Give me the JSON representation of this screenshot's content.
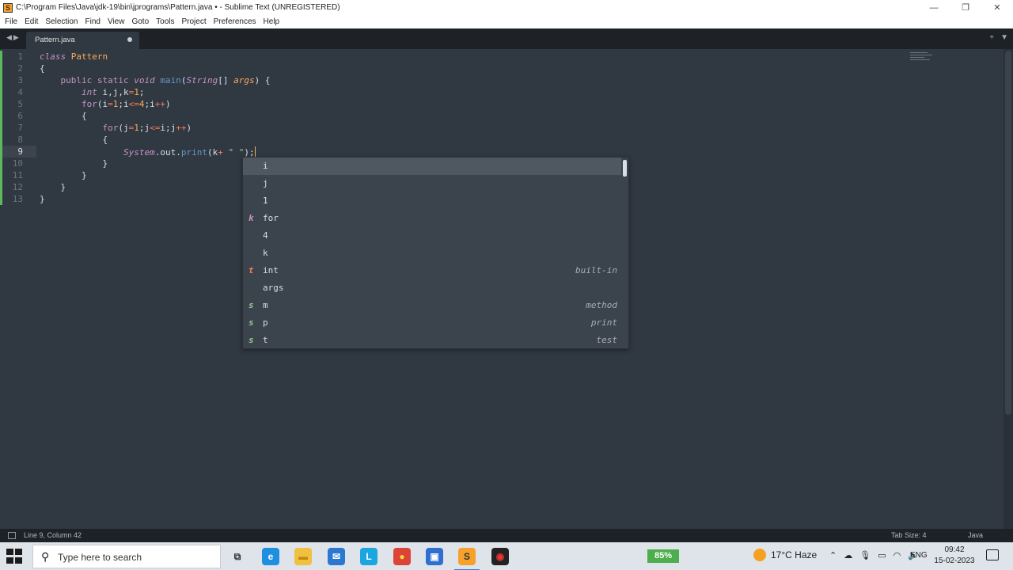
{
  "window": {
    "title": "C:\\Program Files\\Java\\jdk-19\\bin\\jprograms\\Pattern.java • - Sublime Text (UNREGISTERED)",
    "controls": [
      "minimize",
      "restore",
      "close"
    ]
  },
  "menu": [
    "File",
    "Edit",
    "Selection",
    "Find",
    "View",
    "Goto",
    "Tools",
    "Project",
    "Preferences",
    "Help"
  ],
  "tab": {
    "name": "Pattern.java",
    "dirty": true
  },
  "editor": {
    "line_numbers": [
      "1",
      "2",
      "3",
      "4",
      "5",
      "6",
      "7",
      "8",
      "9",
      "10",
      "11",
      "12",
      "13"
    ],
    "active_line": 9,
    "lines": [
      [
        {
          "t": "class",
          "c": "kw"
        },
        {
          "t": " ",
          "c": ""
        },
        {
          "t": "Pattern",
          "c": "cls"
        }
      ],
      [
        {
          "t": "{",
          "c": ""
        }
      ],
      [
        {
          "t": "    ",
          "c": ""
        },
        {
          "t": "public",
          "c": "kw2"
        },
        {
          "t": " ",
          "c": ""
        },
        {
          "t": "static",
          "c": "kw2"
        },
        {
          "t": " ",
          "c": ""
        },
        {
          "t": "void",
          "c": "kw"
        },
        {
          "t": " ",
          "c": ""
        },
        {
          "t": "main",
          "c": "fn"
        },
        {
          "t": "(",
          "c": ""
        },
        {
          "t": "String",
          "c": "ty"
        },
        {
          "t": "[] ",
          "c": ""
        },
        {
          "t": "args",
          "c": "par"
        },
        {
          "t": ") {",
          "c": ""
        }
      ],
      [
        {
          "t": "        ",
          "c": ""
        },
        {
          "t": "int",
          "c": "kw"
        },
        {
          "t": " i,j,k",
          "c": ""
        },
        {
          "t": "=",
          "c": "op"
        },
        {
          "t": "1",
          "c": "num"
        },
        {
          "t": ";",
          "c": ""
        }
      ],
      [
        {
          "t": "        ",
          "c": ""
        },
        {
          "t": "for",
          "c": "kw2"
        },
        {
          "t": "(i",
          "c": ""
        },
        {
          "t": "=",
          "c": "op"
        },
        {
          "t": "1",
          "c": "num"
        },
        {
          "t": ";i",
          "c": ""
        },
        {
          "t": "<=",
          "c": "op"
        },
        {
          "t": "4",
          "c": "num"
        },
        {
          "t": ";i",
          "c": ""
        },
        {
          "t": "++",
          "c": "op"
        },
        {
          "t": ")",
          "c": ""
        }
      ],
      [
        {
          "t": "        {",
          "c": ""
        }
      ],
      [
        {
          "t": "            ",
          "c": ""
        },
        {
          "t": "for",
          "c": "kw2"
        },
        {
          "t": "(j",
          "c": ""
        },
        {
          "t": "=",
          "c": "op"
        },
        {
          "t": "1",
          "c": "num"
        },
        {
          "t": ";j",
          "c": ""
        },
        {
          "t": "<=",
          "c": "op"
        },
        {
          "t": "i;j",
          "c": ""
        },
        {
          "t": "++",
          "c": "op"
        },
        {
          "t": ")",
          "c": ""
        }
      ],
      [
        {
          "t": "            {",
          "c": ""
        }
      ],
      [
        {
          "t": "                ",
          "c": ""
        },
        {
          "t": "System",
          "c": "ty"
        },
        {
          "t": ".out.",
          "c": "obj"
        },
        {
          "t": "print",
          "c": "fn"
        },
        {
          "t": "(k",
          "c": ""
        },
        {
          "t": "+",
          "c": "op"
        },
        {
          "t": " ",
          "c": ""
        },
        {
          "t": "\" \"",
          "c": "str"
        },
        {
          "t": ");",
          "c": ""
        }
      ],
      [
        {
          "t": "            }",
          "c": ""
        }
      ],
      [
        {
          "t": "        }",
          "c": ""
        }
      ],
      [
        {
          "t": "    }",
          "c": ""
        }
      ],
      [
        {
          "t": "}",
          "c": ""
        }
      ]
    ]
  },
  "autocomplete": {
    "items": [
      {
        "kind": "",
        "kind_color": "",
        "label": "i",
        "hint": ""
      },
      {
        "kind": "",
        "kind_color": "",
        "label": "j",
        "hint": ""
      },
      {
        "kind": "",
        "kind_color": "",
        "label": "1",
        "hint": ""
      },
      {
        "kind": "k",
        "kind_color": "#c594c5",
        "label": "for",
        "hint": ""
      },
      {
        "kind": "",
        "kind_color": "",
        "label": "4",
        "hint": ""
      },
      {
        "kind": "",
        "kind_color": "",
        "label": "k",
        "hint": ""
      },
      {
        "kind": "t",
        "kind_color": "#f97b58",
        "label": "int",
        "hint": "built-in"
      },
      {
        "kind": "",
        "kind_color": "",
        "label": "args",
        "hint": ""
      },
      {
        "kind": "s",
        "kind_color": "#99c794",
        "label": "m",
        "hint": "method"
      },
      {
        "kind": "s",
        "kind_color": "#99c794",
        "label": "p",
        "hint": "print"
      },
      {
        "kind": "s",
        "kind_color": "#99c794",
        "label": "t",
        "hint": "test"
      }
    ],
    "selected_index": 0
  },
  "statusbar": {
    "position": "Line 9, Column 42",
    "tab_size": "Tab Size: 4",
    "syntax": "Java"
  },
  "taskbar": {
    "search_placeholder": "Type here to search",
    "battery": "85%",
    "weather": "17°C  Haze",
    "language": "ENG",
    "time": "09:42",
    "date": "15-02-2023",
    "apps": [
      {
        "name": "task-view-icon",
        "color": "transparent",
        "glyph": "⧉",
        "fg": "#333"
      },
      {
        "name": "edge-icon",
        "color": "#1f8fe0",
        "glyph": "e",
        "fg": "#fff"
      },
      {
        "name": "file-explorer-icon",
        "color": "#f0c040",
        "glyph": "▬",
        "fg": "#c08a10"
      },
      {
        "name": "mail-icon",
        "color": "#2b78d0",
        "glyph": "✉",
        "fg": "#fff"
      },
      {
        "name": "l-app-icon",
        "color": "#1aa6e0",
        "glyph": "L",
        "fg": "#fff"
      },
      {
        "name": "chrome-icon",
        "color": "#db4437",
        "glyph": "●",
        "fg": "#fdd835"
      },
      {
        "name": "store-icon",
        "color": "#2f6fd0",
        "glyph": "▣",
        "fg": "#fff"
      },
      {
        "name": "sublime-text-icon",
        "color": "#f6a12c",
        "glyph": "S",
        "fg": "#333"
      },
      {
        "name": "obs-icon",
        "color": "#222",
        "glyph": "◉",
        "fg": "#e33"
      }
    ]
  },
  "colors": {
    "editor_bg": "#303841",
    "accent": "#f9ae58",
    "tabbar_bg": "#1e2227"
  }
}
